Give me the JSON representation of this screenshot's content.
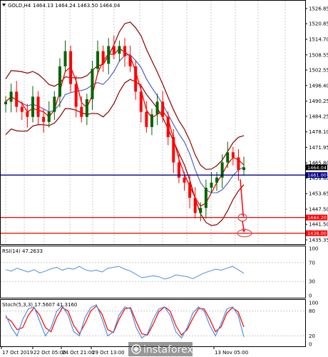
{
  "header": {
    "symbol_timeframe": "GOLD,H4",
    "ohlc": "1464.13 1464.24 1463.50 1464.04"
  },
  "indicators": {
    "rsi_label": "RSI(14) 47.2633",
    "stoch_label": "Stoch(5,3,3) 17.5607 41.3160",
    "rsi_ticks": [
      "100",
      "70",
      "30",
      "0"
    ],
    "stoch_ticks": [
      "100",
      "80",
      "20",
      "0"
    ]
  },
  "watermark": {
    "brand": "instaforex",
    "icon": "instaforex-logo-icon"
  },
  "price_tags": {
    "current": "1464.04",
    "blue_level": "1461.00",
    "red_level_1": "1444.20",
    "red_level_2": "1438.00"
  },
  "time_axis": [
    "17 Oct 2019",
    "22 Oct 05:00",
    "24 Oct 21:00",
    "29 Oct 13:00",
    "13 Nov 05:00"
  ],
  "colors": {
    "candle_up": "#006400",
    "candle_down": "#ff0000",
    "bollinger": "#8b0000",
    "ma_fast": "#ff0000",
    "ma_slow": "#4169e1",
    "blue_level": "#00008b",
    "red_level": "#ff0000",
    "rsi_line": "#4a90e2",
    "stoch_main": "#4a90e2",
    "stoch_signal": "#ff0000",
    "arrow": "#ff0000",
    "target_circle": "#cd5c5c"
  },
  "chart_data": {
    "type": "candlestick",
    "price_axis_ticks": [
      "1526.85",
      "1520.85",
      "1514.70",
      "1508.55",
      "1502.55",
      "1496.40",
      "1490.25",
      "1484.25",
      "1478.10",
      "1471.95",
      "1465.80",
      "1459.80",
      "1453.65",
      "1447.50",
      "1441.50",
      "1435.35"
    ],
    "levels": [
      {
        "name": "blue_level",
        "value": 1461.0
      },
      {
        "name": "red_level_1",
        "value": 1444.2
      },
      {
        "name": "red_level_2",
        "value": 1438.0
      }
    ],
    "close_path": [
      1490,
      1494,
      1488,
      1486,
      1484,
      1492,
      1484,
      1482,
      1486,
      1492,
      1504,
      1510,
      1497,
      1488,
      1484,
      1491,
      1503,
      1510,
      1505,
      1512,
      1509,
      1512,
      1508,
      1504,
      1494,
      1486,
      1480,
      1485,
      1490,
      1484,
      1476,
      1466,
      1460,
      1458,
      1452,
      1446,
      1448,
      1456,
      1458,
      1460,
      1466,
      1470,
      1468,
      1463,
      1464.04
    ],
    "rsi_path": [
      55,
      52,
      58,
      54,
      50,
      55,
      48,
      52,
      57,
      60,
      54,
      58,
      56,
      62,
      55,
      52,
      54,
      50,
      58,
      60,
      62,
      56,
      52,
      45,
      38,
      40,
      42,
      40,
      35,
      38,
      44,
      42,
      40,
      36,
      42,
      48,
      52,
      56,
      54,
      58,
      62,
      55,
      47.26
    ],
    "stoch_main_path": [
      70,
      40,
      20,
      60,
      85,
      90,
      55,
      20,
      40,
      80,
      92,
      70,
      30,
      20,
      65,
      88,
      95,
      60,
      20,
      30,
      70,
      90,
      85,
      40,
      15,
      25,
      60,
      85,
      90,
      70,
      30,
      15,
      40,
      75,
      90,
      80,
      45,
      20,
      50,
      85,
      90,
      70,
      17.56
    ],
    "stoch_signal_path": [
      65,
      55,
      35,
      40,
      70,
      88,
      70,
      40,
      30,
      65,
      88,
      80,
      45,
      25,
      50,
      80,
      92,
      72,
      35,
      28,
      60,
      85,
      88,
      55,
      25,
      22,
      48,
      78,
      90,
      80,
      45,
      22,
      35,
      62,
      86,
      85,
      60,
      30,
      42,
      75,
      88,
      78,
      41.32
    ],
    "projection": {
      "from": 1461.0,
      "to_1": 1444.2,
      "to_2": 1438.0
    }
  }
}
